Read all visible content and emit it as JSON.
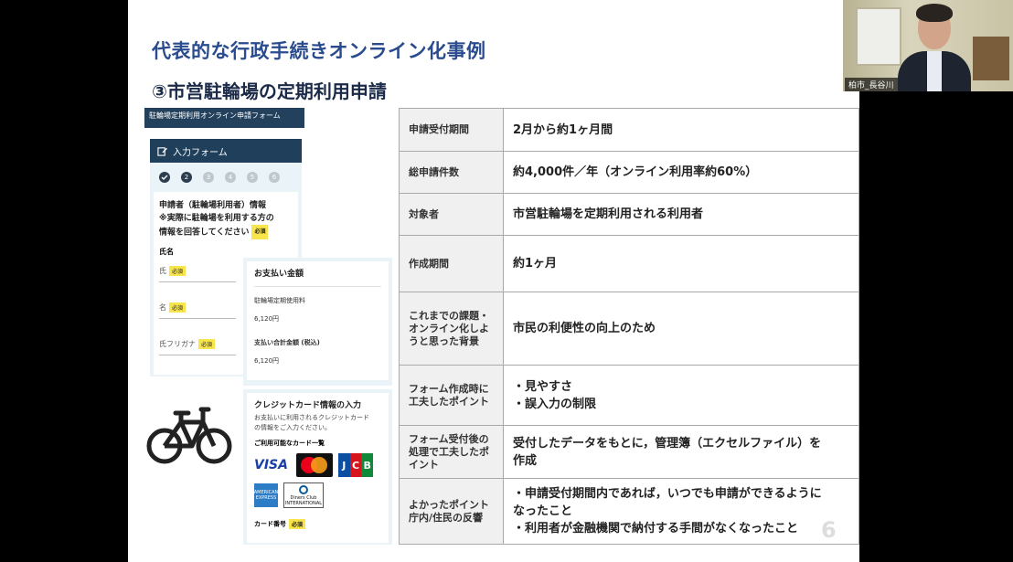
{
  "slide": {
    "title": "代表的な行政手続きオンライン化事例",
    "subtitle": "③市営駐輪場の定期利用申請",
    "page_number": "6"
  },
  "form": {
    "header_bar": "駐輪場定期利用オンライン申請フォーム",
    "panel_title": "入力フォーム",
    "steps": [
      "1",
      "2",
      "3",
      "4",
      "5",
      "6"
    ],
    "note_line1": "申請者（駐輪場利用者）情報",
    "note_line2": "※実際に駐輪場を利用する方の",
    "note_line3": "情報を回答してください",
    "required": "必須",
    "field_group_label": "氏名",
    "field_last": "氏",
    "field_first": "名",
    "field_kana": "氏フリガナ"
  },
  "payment": {
    "title": "お支払い金額",
    "fee_label": "駐輪場定期使用料",
    "fee_value": "6,120円",
    "total_label": "支払い合計金額 (税込)",
    "total_value": "6,120円"
  },
  "credit": {
    "title": "クレジットカード情報の入力",
    "desc_line1": "お支払いに利用されるクレジットカード",
    "desc_line2": "の情報をご入力ください。",
    "available_label": "ご利用可能なカード一覧",
    "visa": "VISA",
    "jcb": [
      "J",
      "C",
      "B"
    ],
    "amex": "AMERICAN EXPRESS",
    "diners": "Diners Club",
    "diners_sub": "INTERNATIONAL",
    "card_number_label": "カード番号",
    "required": "必須"
  },
  "table": {
    "rows": [
      {
        "header": "申請受付期間",
        "value_lines": [
          "2月から約1ヶ月間"
        ]
      },
      {
        "header": "総申請件数",
        "value_lines": [
          "約4,000件／年（オンライン利用率約60%）"
        ]
      },
      {
        "header": "対象者",
        "value_lines": [
          "市営駐輪場を定期利用される利用者"
        ]
      },
      {
        "header": "作成期間",
        "value_lines": [
          "約1ヶ月"
        ]
      },
      {
        "header": "これまでの課題・オンライン化しようと思った背景",
        "value_lines": [
          "市民の利便性の向上のため"
        ]
      },
      {
        "header": "フォーム作成時に工夫したポイント",
        "value_lines": [
          "・見やすさ",
          "・誤入力の制限"
        ]
      },
      {
        "header": "フォーム受付後の処理で工夫したポイント",
        "value_lines": [
          "受付したデータをもとに，管理簿（エクセルファイル）を",
          "作成"
        ]
      },
      {
        "header": "よかったポイント 庁内/住民の反響",
        "value_lines": [
          "・申請受付期間内であれば，いつでも申請ができるように",
          "なったこと",
          "・利用者が金融機関で納付する手間がなくなったこと"
        ]
      }
    ]
  },
  "video": {
    "participant_name": "柏市_長谷川"
  }
}
